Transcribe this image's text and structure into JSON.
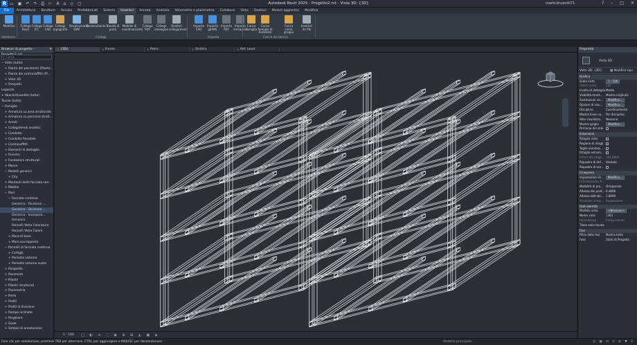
{
  "titlebar": {
    "logo": "R",
    "title": "Autodesk Revit 2025 - Progetto2.rvt - Vista 3D: {3D}",
    "user": "mario.bruentti71",
    "qat_icons": [
      "open-icon",
      "save-icon",
      "undo-icon",
      "redo-icon",
      "print-icon",
      "measure-icon",
      "text-icon",
      "3d-icon",
      "section-icon",
      "close-views-icon"
    ]
  },
  "ribbon_tabs": [
    "File",
    "Architettura",
    "Strutture",
    "Acciaio",
    "Prefabbricati",
    "Sistemi",
    "Inserisci",
    "Annota",
    "Analizza",
    "Volumetrie e planimetria",
    "Collabora",
    "Vista",
    "Gestisci",
    "Moduli aggiuntivi",
    "Modifica"
  ],
  "active_tab": "Inserisci",
  "ribbon": {
    "buttons": [
      {
        "label": "Modifica",
        "icon": "pointer-icon",
        "color": "#5aa0e8"
      },
      {
        "label": "Collega Revit",
        "icon": "link-revit-icon",
        "color": "#4a90d9"
      },
      {
        "label": "Collega IFC",
        "icon": "link-ifc-icon",
        "color": "#4a90d9"
      },
      {
        "label": "Collega CAD",
        "icon": "link-cad-icon",
        "color": "#4a90d9"
      },
      {
        "label": "Collega topografia",
        "icon": "link-topo-icon",
        "color": "#c9a45a"
      },
      {
        "label": "Decalcomania DWF",
        "icon": "dwf-icon",
        "color": "#7fb3e0"
      },
      {
        "label": "Decalcomanie",
        "icon": "decal-icon",
        "color": "#a0aab5"
      },
      {
        "label": "Nuvola di punti",
        "icon": "point-cloud-icon",
        "color": "#a0aab5"
      },
      {
        "label": "Modello di coordinamento",
        "icon": "coord-model-icon",
        "color": "#a0aab5"
      },
      {
        "label": "Collega PDF",
        "icon": "pdf-icon",
        "color": "#6b737d"
      },
      {
        "label": "Collega immagine",
        "icon": "image-icon",
        "color": "#6b737d"
      },
      {
        "label": "Gestisci collegamenti",
        "icon": "manage-links-icon",
        "color": "#a0aab5"
      },
      {
        "label": "Importa CAD",
        "icon": "import-cad-icon",
        "color": "#4a90d9"
      },
      {
        "label": "Importa gbXML",
        "icon": "gbxml-icon",
        "color": "#4a90d9"
      },
      {
        "label": "Importa PDF",
        "icon": "import-pdf-icon",
        "color": "#6b737d"
      },
      {
        "label": "Importa immagine",
        "icon": "import-image-icon",
        "color": "#6b737d"
      },
      {
        "label": "Carica famiglia",
        "icon": "load-family-icon",
        "color": "#d9a54a"
      },
      {
        "label": "Carica famiglie di Autodesk",
        "icon": "autodesk-family-icon",
        "color": "#d9a54a"
      },
      {
        "label": "Carica come gruppo",
        "icon": "load-group-icon",
        "color": "#d9a54a"
      },
      {
        "label": "Inserisci da file",
        "icon": "insert-file-icon",
        "color": "#a0aab5"
      }
    ],
    "panels": [
      "Selezione",
      "Collega",
      "Importa",
      "Carica da libreria"
    ]
  },
  "browser": {
    "title": "Browser di progetto - Progetto2.rvt",
    "search_placeholder": "Cerca",
    "items": [
      {
        "label": "Viste (tutto)",
        "indent": 0,
        "sign": "−"
      },
      {
        "label": "Piante dei pavimenti (Pianta ...)",
        "indent": 1,
        "sign": "+"
      },
      {
        "label": "Piante dei controsoffitti (Pi...",
        "indent": 1,
        "sign": "+"
      },
      {
        "label": "Viste 3D",
        "indent": 1,
        "sign": "+"
      },
      {
        "label": "Prospetti",
        "indent": 1,
        "sign": "+"
      },
      {
        "label": "Legende",
        "indent": 0,
        "sign": ""
      },
      {
        "label": "Abachi/Quantità (tutto)",
        "indent": 0,
        "sign": "+"
      },
      {
        "label": "Tavole (tutto)",
        "indent": 0,
        "sign": ""
      },
      {
        "label": "Famiglie",
        "indent": 0,
        "sign": "−"
      },
      {
        "label": "Armatura su area strutturale",
        "indent": 1,
        "sign": "+"
      },
      {
        "label": "Armatura su percorso strutt...",
        "indent": 1,
        "sign": "+"
      },
      {
        "label": "Arredi",
        "indent": 1,
        "sign": "+"
      },
      {
        "label": "Collegamenti analitici",
        "indent": 1,
        "sign": "+"
      },
      {
        "label": "Condotto",
        "indent": 1,
        "sign": "+"
      },
      {
        "label": "Condotto flessibile",
        "indent": 1,
        "sign": "+"
      },
      {
        "label": "Controsoffitti",
        "indent": 1,
        "sign": "+"
      },
      {
        "label": "Elementi di dettaglio",
        "indent": 1,
        "sign": "+"
      },
      {
        "label": "Finestre",
        "indent": 1,
        "sign": "+"
      },
      {
        "label": "Fondazioni strutturali",
        "indent": 1,
        "sign": "+"
      },
      {
        "label": "Masse",
        "indent": 1,
        "sign": "+"
      },
      {
        "label": "Modelli generici",
        "indent": 1,
        "sign": "−"
      },
      {
        "label": "City",
        "indent": 2,
        "sign": "+"
      },
      {
        "label": "Montanti della facciata con...",
        "indent": 1,
        "sign": "+"
      },
      {
        "label": "Mobilio",
        "indent": 1,
        "sign": "+"
      },
      {
        "label": "Muri",
        "indent": 1,
        "sign": "−"
      },
      {
        "label": "Facciata continua",
        "indent": 2,
        "sign": "−"
      },
      {
        "label": "Generica - Divisione ...",
        "indent": 3,
        "sign": ""
      },
      {
        "label": "Generica - Divisione ...",
        "indent": 3,
        "sign": "",
        "selected": true
      },
      {
        "label": "Generica - Incorpora...",
        "indent": 3,
        "sign": ""
      },
      {
        "label": "Generico",
        "indent": 3,
        "sign": ""
      },
      {
        "label": "Pannelli Vetro Coloratura",
        "indent": 3,
        "sign": ""
      },
      {
        "label": "Pannelli Vetro Colore",
        "indent": 3,
        "sign": ""
      },
      {
        "label": "Muro di base",
        "indent": 2,
        "sign": "+"
      },
      {
        "label": "Muro sovrapposto",
        "indent": 2,
        "sign": "+"
      },
      {
        "label": "Pannelli di facciata continua",
        "indent": 1,
        "sign": "−"
      },
      {
        "label": "Cartiglij",
        "indent": 2,
        "sign": "+"
      },
      {
        "label": "Pannello sistema",
        "indent": 2,
        "sign": "+"
      },
      {
        "label": "Pannello sistema vuoto",
        "indent": 2,
        "sign": "+"
      },
      {
        "label": "Parapetto",
        "indent": 1,
        "sign": "+"
      },
      {
        "label": "Pavimenti",
        "indent": 1,
        "sign": "+"
      },
      {
        "label": "Pilastri",
        "indent": 1,
        "sign": "+"
      },
      {
        "label": "Pilastri strutturali",
        "indent": 1,
        "sign": "+"
      },
      {
        "label": "Planimetria",
        "indent": 1,
        "sign": "+"
      },
      {
        "label": "Porte",
        "indent": 1,
        "sign": "+"
      },
      {
        "label": "Profili",
        "indent": 1,
        "sign": "+"
      },
      {
        "label": "Profili di divisione",
        "indent": 1,
        "sign": "+"
      },
      {
        "label": "Rampe inclinate",
        "indent": 1,
        "sign": "+"
      },
      {
        "label": "Ringhiere",
        "indent": 1,
        "sign": "+"
      },
      {
        "label": "Scale",
        "indent": 1,
        "sign": "+"
      },
      {
        "label": "Simboli di annotazione",
        "indent": 1,
        "sign": "+"
      }
    ]
  },
  "view_tabs": [
    {
      "label": "{3D}",
      "active": true
    },
    {
      "label": "Fronte",
      "active": false
    },
    {
      "label": "Retro",
      "active": false
    },
    {
      "label": "Sinistra",
      "active": false
    },
    {
      "label": "Ref. Level",
      "active": false
    }
  ],
  "viewbar": {
    "scale": "1 : 100",
    "icons": "□ ◐ ☀ ⛶ ◉ ⊕ ⊞ ◭ ▣ ◈"
  },
  "statusbar": {
    "message": "Fare clic per selezionare, premere TAB per alternare, CTRL per aggiungere e MAIUSC per deselezionare.",
    "model": "Modello principale",
    "right_icons": "◎ ▦ ⊡ ⚲ ⊕ ▼ 0"
  },
  "properties": {
    "title": "Proprietà",
    "type_name": "Vista 3D",
    "selector": "Viste 3D: {3D}",
    "edit_type": "Modifica tipo",
    "sections": [
      {
        "name": "Grafica",
        "rows": [
          {
            "k": "Scala vista",
            "v": "1 : 100",
            "boxed": true
          },
          {
            "k": "Valore scala",
            "v": "100",
            "dim": true
          },
          {
            "k": "Livello di dettaglio",
            "v": "Medio"
          },
          {
            "k": "Visibilità strutt...",
            "v": "Mostra originale"
          },
          {
            "k": "Sostituzioni vis...",
            "v": "Modifica...",
            "btn": true
          },
          {
            "k": "Opzioni di visu...",
            "v": "Modifica...",
            "btn": true
          },
          {
            "k": "Disciplina",
            "v": "Coordinamento"
          },
          {
            "k": "Mostra linee na...",
            "v": "Per disciplina"
          },
          {
            "k": "Stile visualizza...",
            "v": "Nessuno"
          },
          {
            "k": "Mostra griglia",
            "v": "Modifica...",
            "btn": true
          },
          {
            "k": "Percorso del sole",
            "v": "",
            "chk": true
          }
        ]
      },
      {
        "name": "Estensioni",
        "rows": [
          {
            "k": "Ritaglia vista",
            "v": "",
            "chk": true
          },
          {
            "k": "Regione di ritagli...",
            "v": "",
            "chk": true
          },
          {
            "k": "Taglio annotazi...",
            "v": "",
            "chk": true
          },
          {
            "k": "Ritaglio estrem...",
            "v": "",
            "chk": true
          },
          {
            "k": "Offset del ritagl...",
            "v": "304.8000",
            "dim": true
          },
          {
            "k": "Riquadro di def...",
            "v": "Ventato"
          },
          {
            "k": "Riquadro di sez...",
            "v": "",
            "chk": true
          }
        ]
      },
      {
        "name": "Cinepresa",
        "rows": [
          {
            "k": "Impostazioni di ...",
            "v": "Modifica...",
            "btn": true
          },
          {
            "k": "Orientamento fi...",
            "v": "",
            "dim": true
          },
          {
            "k": "Modalità di pro...",
            "v": "Ortogonale"
          },
          {
            "k": "Altezza del punt...",
            "v": "6.4896"
          },
          {
            "k": "Altezza dell'obi...",
            "v": "1.8690"
          },
          {
            "k": "Posizione cinep...",
            "v": "Regolazione",
            "dim": true
          }
        ]
      },
      {
        "name": "Dati identità",
        "rows": [
          {
            "k": "Modello vista",
            "v": "<Nessuno>",
            "btn": true
          },
          {
            "k": "Nome vista",
            "v": "{3D}"
          },
          {
            "k": "Dipendenza",
            "v": "Indipendente",
            "dim": true
          },
          {
            "k": "Titolo sulla tavola",
            "v": ""
          }
        ]
      },
      {
        "name": "Fasi",
        "rows": [
          {
            "k": "Filtro delle fasi",
            "v": "Mostra tutto"
          },
          {
            "k": "Fase",
            "v": "Stato di Progetto"
          }
        ]
      }
    ]
  }
}
